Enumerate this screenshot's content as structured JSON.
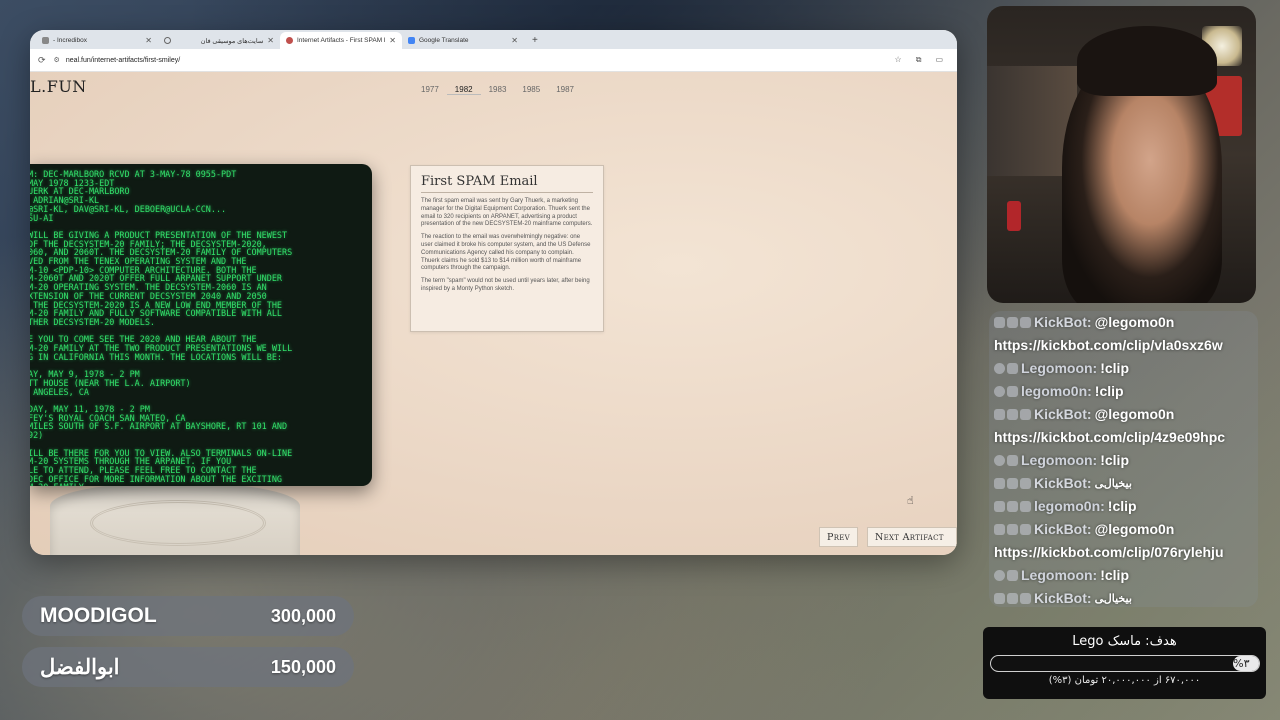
{
  "browser": {
    "tabs": [
      {
        "title": "- Incredibox",
        "icon": "incredibox-icon"
      },
      {
        "title": "سایت‌های موسیقی فان",
        "icon": "globe-icon"
      },
      {
        "title": "Internet Artifacts - First SPAM E",
        "icon": "neal-fun-icon",
        "active": true
      },
      {
        "title": "Google Translate",
        "icon": "google-translate-icon"
      }
    ],
    "url": "neal.fun/internet-artifacts/first-smiley/"
  },
  "page": {
    "logo": "L.FUN",
    "years": [
      "1977",
      "1982",
      "1983",
      "1985",
      "1987"
    ],
    "selected_year": "1982",
    "terminal_text": "M: DEC-MARLBORO RCVD AT 3-MAY-78 0955-PDT\nMAY 1978 1233-EDT\nUERK AT DEC-MARLBORO\n ADRIAN@SRI-KL\n@SRI-KL, DAV@SRI-KL, DEBOER@UCLA-CCN...\nSU-AI\n\nWILL BE GIVING A PRODUCT PRESENTATION OF THE NEWEST\nOF THE DECSYSTEM-20 FAMILY; THE DECSYSTEM-2020,\n060, AND 2060T. THE DECSYSTEM-20 FAMILY OF COMPUTERS\nVED FROM THE TENEX OPERATING SYSTEM AND THE\nM-10 <PDP-10> COMPUTER ARCHITECTURE. BOTH THE\nM-2060T AND 2020T OFFER FULL ARPANET SUPPORT UNDER\nM-20 OPERATING SYSTEM. THE DECSYSTEM-2060 IS AN\nXTENSION OF THE CURRENT DECSYSTEM 2040 AND 2050\n THE DECSYSTEM-2020 IS A NEW LOW END MEMBER OF THE\nM-20 FAMILY AND FULLY SOFTWARE COMPATIBLE WITH ALL\nTHER DECSYSTEM-20 MODELS.\n\nE YOU TO COME SEE THE 2020 AND HEAR ABOUT THE\nM-20 FAMILY AT THE TWO PRODUCT PRESENTATIONS WE WILL\nG IN CALIFORNIA THIS MONTH. THE LOCATIONS WILL BE:\n\nAY, MAY 9, 1978 - 2 PM\nTT HOUSE (NEAR THE L.A. AIRPORT)\n ANGELES, CA\n\nDAY, MAY 11, 1978 - 2 PM\nFEY'S ROYAL COACH SAN MATEO, CA\nMILES SOUTH OF S.F. AIRPORT AT BAYSHORE, RT 101 AND\n92)\n\nILL BE THERE FOR YOU TO VIEW. ALSO TERMINALS ON-LINE\nM-20 SYSTEMS THROUGH THE ARPANET. IF YOU\nLE TO ATTEND, PLEASE FEEL FREE TO CONTACT THE\nDEC OFFICE FOR MORE INFORMATION ABOUT THE EXCITING\nM-20 FAMILY.",
    "card": {
      "title": "First SPAM Email",
      "p1": "The first spam email was sent by Gary Thuerk, a marketing manager for the Digital Equipment Corporation. Thuerk sent the email to 320 recipients on ARPANET, advertising a product presentation of the new DECSYSTEM-20 mainframe computers.",
      "p2": "The reaction to the email was overwhelmingly negative: one user claimed it broke his computer system, and the US Defense Communications Agency called his company to complain. Thuerk claims he sold $13 to $14 million worth of mainframe computers through the campaign.",
      "p3": "The term \"spam\" would not be used until years later, after being inspired by a Monty Python sketch."
    },
    "prev_label": "Prev",
    "next_label": "Next Artifact"
  },
  "chat": [
    {
      "user": "KickBot:",
      "text": "@legomo0n",
      "user_style": "kick"
    },
    {
      "user": "",
      "text": "https://kickbot.com/clip/vla0sxz6w"
    },
    {
      "user": "Legomoon:",
      "text": "!clip",
      "user_style": "lego"
    },
    {
      "user": "legomo0n:",
      "text": "!clip",
      "user_style": "lego"
    },
    {
      "user": "KickBot:",
      "text": "@legomo0n",
      "user_style": "kick"
    },
    {
      "user": "",
      "text": "https://kickbot.com/clip/4z9e09hpc"
    },
    {
      "user": "Legomoon:",
      "text": "!clip",
      "user_style": "lego"
    },
    {
      "user": "KickBot:",
      "text": "ﺑﯿﺨﯿﺎﻝﯽ",
      "user_style": "kick"
    },
    {
      "user": "legomo0n:",
      "text": "!clip",
      "user_style": "lego"
    },
    {
      "user": "KickBot:",
      "text": "@legomo0n",
      "user_style": "kick"
    },
    {
      "user": "",
      "text": "https://kickbot.com/clip/076rylehju"
    },
    {
      "user": "Legomoon:",
      "text": "!clip",
      "user_style": "lego"
    },
    {
      "user": "KickBot:",
      "text": "ﺑﯿﺨﯿﺎﻝﯽ",
      "user_style": "kick"
    }
  ],
  "goal": {
    "title": "هدف: ماسک Lego",
    "percent_label": "%۳",
    "progress_fraction": 0.03,
    "subtitle": "۶۷۰,۰۰۰ از ۲۰,۰۰۰,۰۰۰ تومان (۳%)"
  },
  "donations": [
    {
      "name": "MOODIGOL",
      "amount": "300,000"
    },
    {
      "name": "ابوالفضل",
      "amount": "150,000"
    }
  ]
}
